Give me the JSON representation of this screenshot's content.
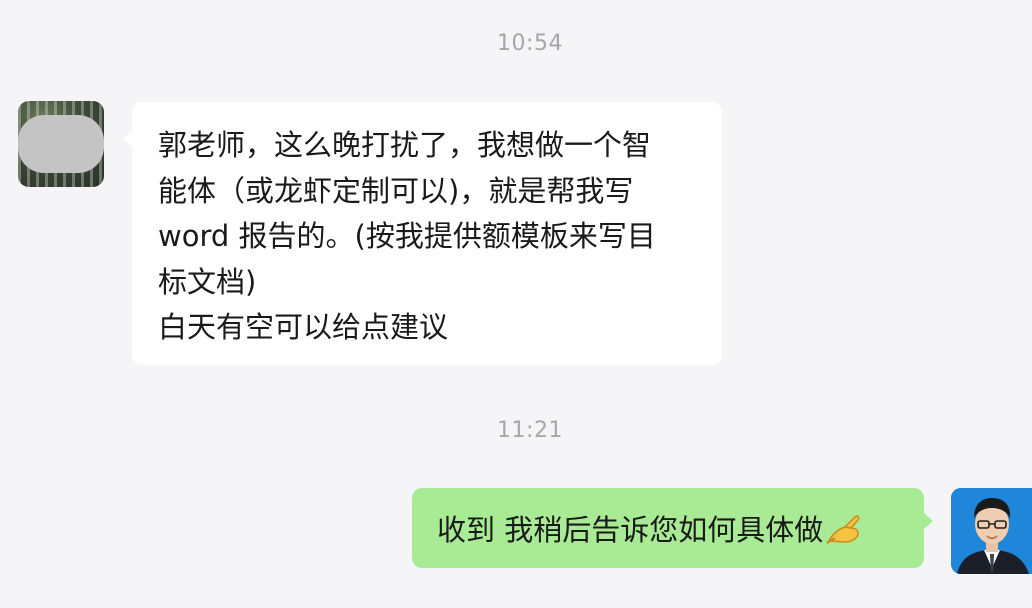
{
  "conversation": {
    "messages": [
      {
        "time": "10:54",
        "sender": "contact",
        "lines": [
          "郭老师，这么晚打扰了，我想做一个智",
          "能体（或龙虾定制可以)，就是帮我写",
          "word 报告的。(按我提供额模板来写目",
          "标文档)",
          "白天有空可以给点建议"
        ]
      },
      {
        "time": "11:21",
        "sender": "self",
        "text": "收到 我稍后告诉您如何具体做",
        "emoji": "pinching-hand-emoji-icon"
      }
    ]
  },
  "colors": {
    "background": "#f5f5f7",
    "incoming_bubble": "#ffffff",
    "outgoing_bubble": "#a9ea95",
    "timestamp_text": "#a6a6aa",
    "message_text": "#1a1a1a"
  }
}
